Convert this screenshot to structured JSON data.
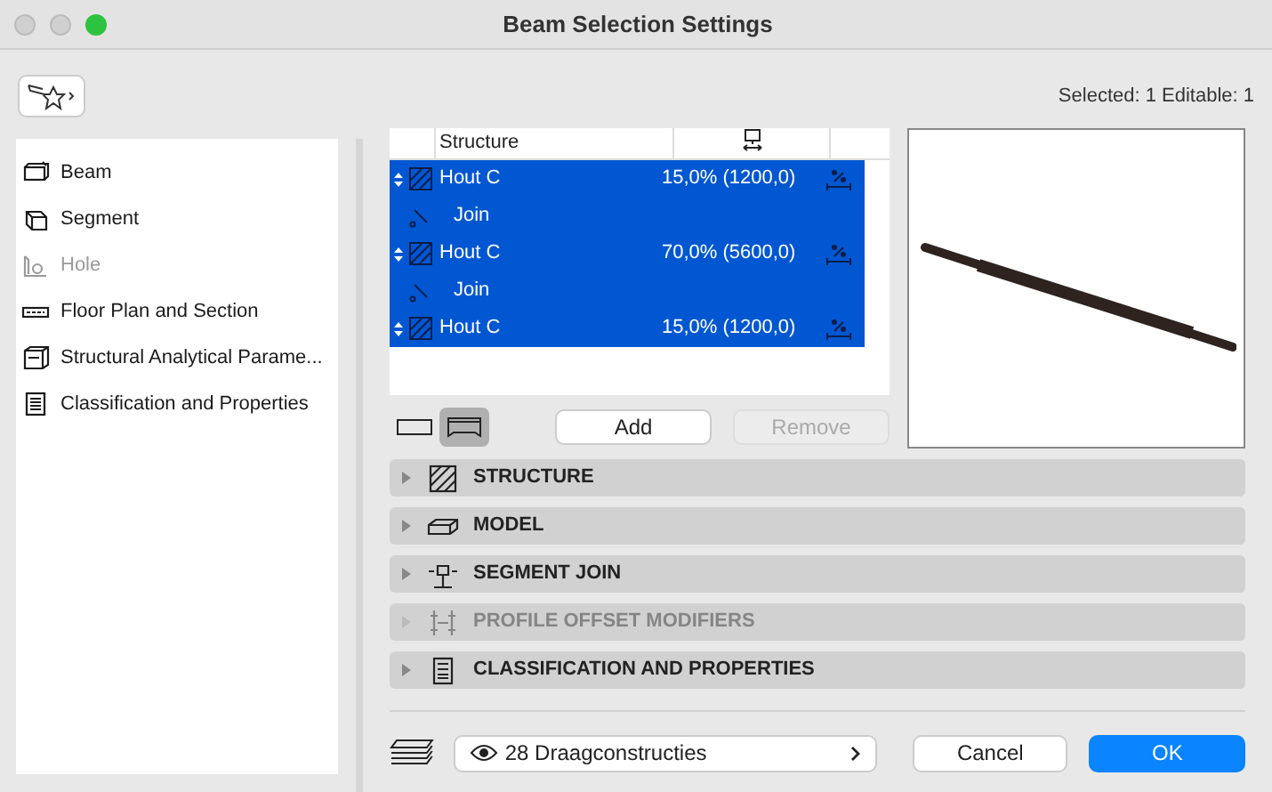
{
  "window": {
    "title": "Beam Selection Settings"
  },
  "selection_info": "Selected: 1 Editable: 1",
  "sidebar": {
    "items": [
      {
        "label": "Beam",
        "kind": "beam",
        "disabled": false
      },
      {
        "label": "Segment",
        "kind": "segment",
        "disabled": false
      },
      {
        "label": "Hole",
        "kind": "hole",
        "disabled": true
      },
      {
        "label": "Floor Plan and Section",
        "kind": "plan",
        "disabled": false
      },
      {
        "label": "Structural Analytical Parame...",
        "kind": "analytical",
        "disabled": false
      },
      {
        "label": "Classification and Properties",
        "kind": "classification",
        "disabled": false
      }
    ]
  },
  "table": {
    "columns": [
      "Structure"
    ],
    "rows": [
      {
        "kind": "layer",
        "name": "Hout C",
        "value": "15,0% (1200,0)",
        "selected": true
      },
      {
        "kind": "join",
        "name": "Join",
        "selected": true
      },
      {
        "kind": "layer",
        "name": "Hout C",
        "value": "70,0% (5600,0)",
        "selected": true
      },
      {
        "kind": "join",
        "name": "Join",
        "selected": true
      },
      {
        "kind": "layer",
        "name": "Hout C",
        "value": "15,0% (1200,0)",
        "selected": true
      }
    ]
  },
  "view_toggles": [
    {
      "kind": "plain",
      "selected": false
    },
    {
      "kind": "profile",
      "selected": true
    }
  ],
  "buttons": [
    {
      "label": "Add",
      "disabled": false
    },
    {
      "label": "Remove",
      "disabled": true
    }
  ],
  "sections": [
    {
      "label": "STRUCTURE",
      "kind": "structure",
      "disabled": false
    },
    {
      "label": "MODEL",
      "kind": "model",
      "disabled": false
    },
    {
      "label": "SEGMENT JOIN",
      "kind": "join",
      "disabled": false
    },
    {
      "label": "PROFILE OFFSET MODIFIERS",
      "kind": "offset",
      "disabled": true
    },
    {
      "label": "CLASSIFICATION AND PROPERTIES",
      "kind": "classification",
      "disabled": false
    }
  ],
  "layer_selector": {
    "value": "28 Draagconstructies"
  },
  "footer_buttons": [
    {
      "label": "Cancel",
      "kind": "secondary"
    },
    {
      "label": "OK",
      "kind": "primary"
    }
  ]
}
